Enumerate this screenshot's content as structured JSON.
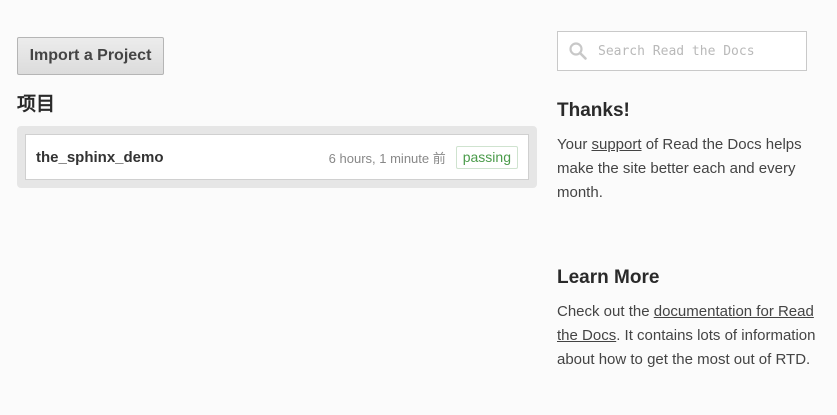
{
  "left": {
    "import_button": "Import a Project",
    "section_title": "项目",
    "projects": [
      {
        "name": "the_sphinx_demo",
        "time": "6 hours, 1 minute 前",
        "status": "passing"
      }
    ]
  },
  "right": {
    "search": {
      "placeholder": "Search Read the Docs",
      "value": ""
    },
    "thanks": {
      "heading": "Thanks!",
      "text_before": "Your ",
      "link": "support",
      "text_after": " of Read the Docs helps make the site better each and every month."
    },
    "learn_more": {
      "heading": "Learn More",
      "text_before": "Check out the ",
      "link": "documentation for Read the Docs",
      "text_after": ". It contains lots of information about how to get the most out of RTD."
    }
  },
  "colors": {
    "badge_text": "#4a9b4a",
    "background": "#fbfbfb"
  },
  "icons": {
    "search": "search-icon"
  }
}
